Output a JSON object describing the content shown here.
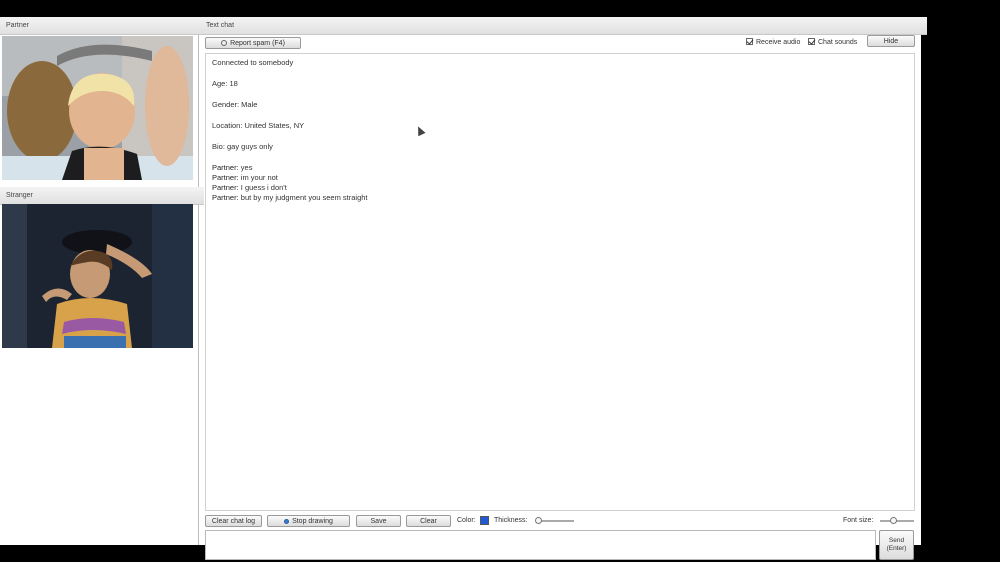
{
  "partner_panel": {
    "title": "Partner"
  },
  "you_panel": {
    "title": "Stranger"
  },
  "chat_panel": {
    "title": "Text chat"
  },
  "toolbar_top": {
    "report_spam": "Report spam (F4)",
    "receive_audio": "Receive audio",
    "chat_sounds": "Chat sounds",
    "hide": "Hide"
  },
  "chat_log": {
    "info": [
      "Connected to somebody",
      "Age: 18",
      "Gender: Male",
      "Location: United States, NY",
      "Bio: gay guys only"
    ],
    "messages": [
      {
        "who": "Partner:",
        "text": "yes"
      },
      {
        "who": "Partner:",
        "text": "im your not"
      },
      {
        "who": "Partner:",
        "text": "I guess i don't"
      },
      {
        "who": "Partner:",
        "text": "but by my judgment you seem straight"
      }
    ]
  },
  "toolbar_bottom": {
    "clear_log": "Clear chat log",
    "stop_drawing": "Stop drawing",
    "save": "Save",
    "clear": "Clear",
    "color_label": "Color:",
    "color_value": "#1f5bd6",
    "thickness_label": "Thickness:",
    "font_size_label": "Font size:"
  },
  "input": {
    "value": ""
  },
  "send": {
    "line1": "Send",
    "line2": "(Enter)"
  }
}
